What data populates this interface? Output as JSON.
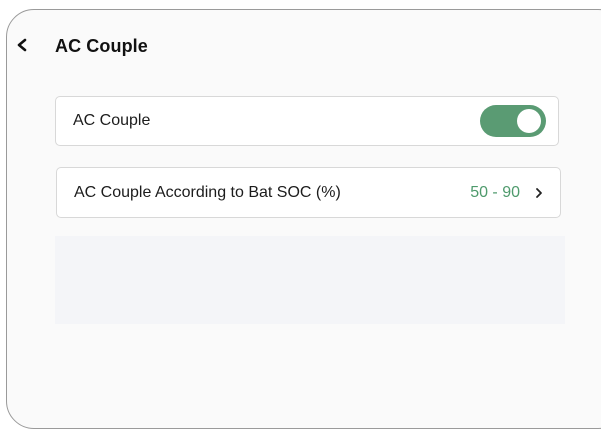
{
  "header": {
    "title": "AC Couple",
    "back_icon": "chevron-left-icon"
  },
  "settings": {
    "ac_couple": {
      "label": "AC Couple",
      "enabled": true,
      "toggle_color": "#5a9b73"
    },
    "soc_range": {
      "label": "AC Couple According to Bat SOC (%)",
      "value": "50 - 90",
      "value_color": "#4e9a6c",
      "chevron_icon": "chevron-right-icon"
    }
  }
}
